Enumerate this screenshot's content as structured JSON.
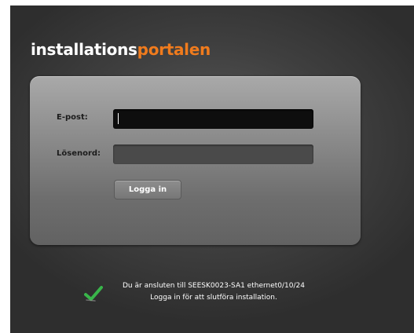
{
  "logo": {
    "part1": "installations",
    "part2": "portalen"
  },
  "form": {
    "email_label": "E-post:",
    "email_value": "",
    "password_label": "Lösenord:",
    "password_value": "",
    "login_button": "Logga in"
  },
  "status": {
    "line1": "Du är ansluten till SEESK0023-SA1 ethernet0/10/24",
    "line2": "Logga in för att slutföra installation.",
    "icon": "checkmark-icon"
  },
  "colors": {
    "brand_orange": "#f07b1d",
    "check_green": "#39b54a"
  }
}
